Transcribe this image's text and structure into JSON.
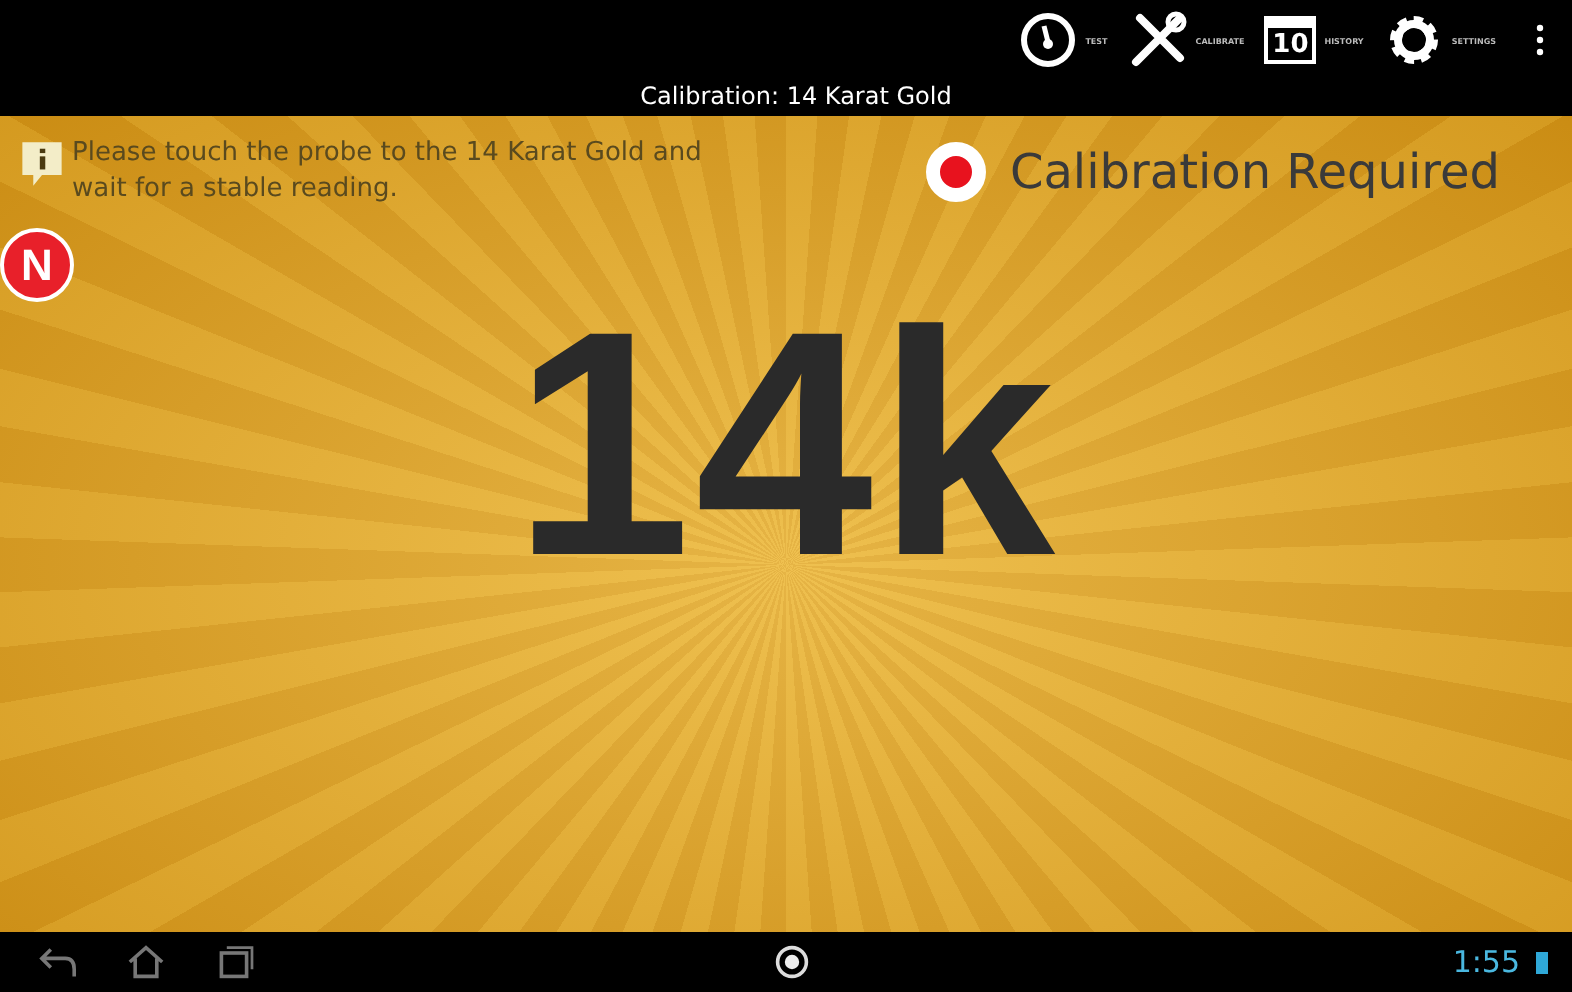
{
  "action_bar": {
    "items": [
      {
        "kind": "gauge",
        "label": "TEST"
      },
      {
        "kind": "tools",
        "label": "CALIBRATE"
      },
      {
        "kind": "calendar",
        "label": "HISTORY",
        "icon_text": "10"
      },
      {
        "kind": "gear",
        "label": "SETTINGS"
      }
    ],
    "title": "Calibration: 14 Karat Gold"
  },
  "instruction": "Please touch the probe to the 14 Karat Gold and wait for a stable reading.",
  "callout": "N",
  "status": {
    "label": "Calibration Required",
    "color": "#e8121e"
  },
  "reading": "14k",
  "nav_bar": {
    "time": "1:55"
  }
}
